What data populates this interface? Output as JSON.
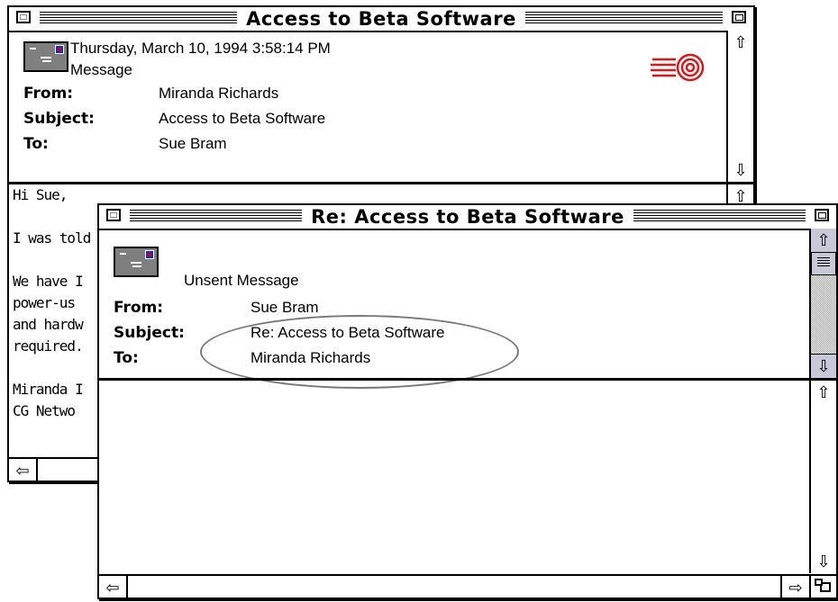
{
  "back_window": {
    "title": "Access to Beta Software",
    "date": "Thursday, March 10, 1994 3:58:14 PM",
    "kind": "Message",
    "from_label": "From:",
    "from_value": "Miranda Richards",
    "subject_label": "Subject:",
    "subject_value": "Access to Beta Software",
    "to_label": "To:",
    "to_value": "Sue Bram",
    "body_lines": [
      "Hi Sue,",
      "",
      "I was told",
      "",
      "We have I",
      "power-us",
      "and hardw",
      "required.",
      "",
      "Miranda I",
      "CG Netwo"
    ]
  },
  "front_window": {
    "title": "Re: Access to Beta Software",
    "kind": "Unsent Message",
    "from_label": "From:",
    "from_value": "Sue Bram",
    "subject_label": "Subject:",
    "subject_value": "Re: Access to Beta Software",
    "to_label": "To:",
    "to_value": "Miranda Richards"
  },
  "icons": {
    "close": "close-box-icon",
    "zoom": "zoom-box-icon",
    "mail": "mail-envelope-icon",
    "postmark": "postmark-stamp-icon",
    "up": "up-arrow-icon",
    "down": "down-arrow-icon",
    "left": "left-arrow-icon",
    "right": "right-arrow-icon",
    "grow": "grow-box-icon"
  },
  "colors": {
    "postmark": "#d81818",
    "stamp_blue": "#1030c0",
    "icon_gray": "#7f7f7f",
    "scroll_thumb": "#c8c8d8"
  }
}
